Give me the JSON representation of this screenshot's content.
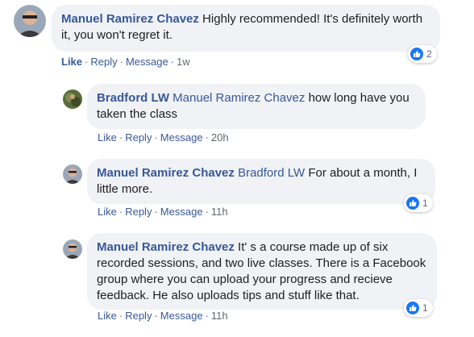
{
  "comments": [
    {
      "author": "Manuel Ramirez Chavez",
      "mention": "",
      "text": " Highly recommended! It's definitely worth it, you won't regret it.",
      "actions": {
        "like": "Like",
        "reply": "Reply",
        "message": "Message",
        "time": "1w"
      },
      "reaction_count": "2"
    },
    {
      "author": "Bradford LW",
      "mention": "Manuel Ramirez Chavez",
      "text": " how long have you taken the class",
      "actions": {
        "like": "Like",
        "reply": "Reply",
        "message": "Message",
        "time": "20h"
      },
      "reaction_count": ""
    },
    {
      "author": "Manuel Ramirez Chavez",
      "mention": "Bradford LW",
      "text": " For about a month, I little more.",
      "actions": {
        "like": "Like",
        "reply": "Reply",
        "message": "Message",
        "time": "11h"
      },
      "reaction_count": "1"
    },
    {
      "author": "Manuel Ramirez Chavez",
      "mention": "",
      "text": " It' s a course made up of six recorded sessions, and two live classes. There is a Facebook group where you can upload your progress and recieve feedback. He also uploads tips and stuff like that.",
      "actions": {
        "like": "Like",
        "reply": "Reply",
        "message": "Message",
        "time": "11h"
      },
      "reaction_count": "1"
    }
  ],
  "separator": "·",
  "colors": {
    "bubble_bg": "#f0f2f5",
    "link": "#385898",
    "meta": "#606770",
    "reaction_blue": "#1877f2"
  }
}
